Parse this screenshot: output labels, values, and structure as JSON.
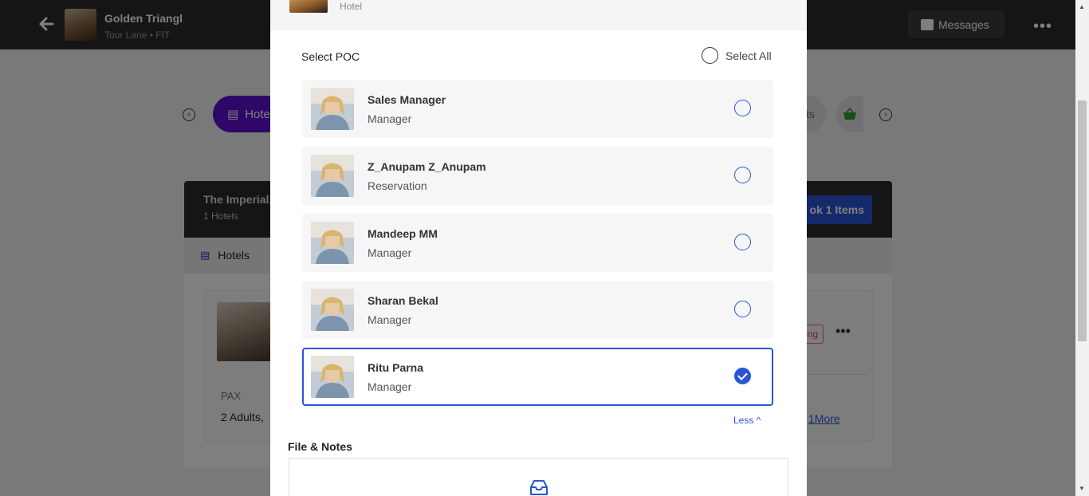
{
  "topbar": {
    "trip_title": "Golden Triangl",
    "trip_subtitle": "Tour Lane • FIT",
    "messages_label": "Messages",
    "more_label": "•••"
  },
  "tabs": {
    "hotels_label": "Hotel",
    "extras_label": "ts"
  },
  "booking_card": {
    "title": "The Imperial,",
    "subtitle": "1 Hotels",
    "book_label": "ok 1 Items",
    "subtab_label": "Hotels",
    "pax_label": "PAX",
    "pax_value": "2 Adults,",
    "status_text": "ng",
    "more_link": "1More"
  },
  "modal": {
    "item_type": "Hotel",
    "poc_title": "Select POC",
    "select_all_label": "Select All",
    "poc_list": [
      {
        "name": "Sales Manager",
        "role": "Manager",
        "selected": false
      },
      {
        "name": "Z_Anupam Z_Anupam",
        "role": "Reservation",
        "selected": false
      },
      {
        "name": "Mandeep MM",
        "role": "Manager",
        "selected": false
      },
      {
        "name": "Sharan Bekal",
        "role": "Manager",
        "selected": false
      },
      {
        "name": "Ritu Parna",
        "role": "Manager",
        "selected": true
      }
    ],
    "less_label": "Less ^",
    "files_title": "File & Notes"
  },
  "icons": {
    "back": "arrow-left-icon",
    "messages": "chat-icon",
    "bed": "bed-icon",
    "basket": "basket-icon",
    "upload": "inbox-icon"
  },
  "colors": {
    "accent_purple": "#5f0fd1",
    "primary_blue": "#2a55d6",
    "topbar_bg": "#2b2b2b"
  }
}
